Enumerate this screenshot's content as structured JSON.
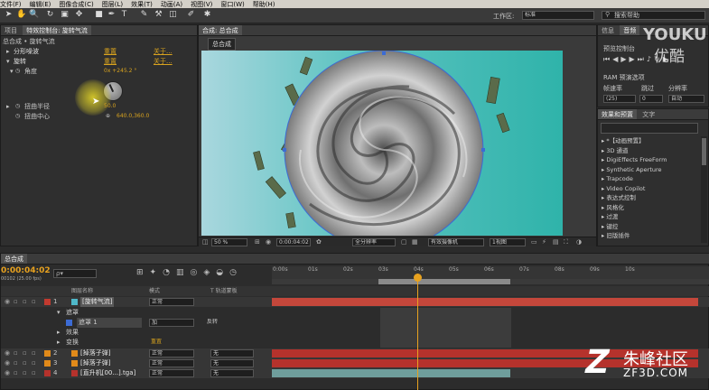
{
  "menu": [
    "文件(F)",
    "编辑(E)",
    "图像合成(C)",
    "图层(L)",
    "效果(T)",
    "动画(A)",
    "视图(V)",
    "窗口(W)",
    "帮助(H)"
  ],
  "toolbar": {
    "workspace_label": "工作区:",
    "workspace_value": "标准",
    "search_placeholder": "搜索帮助"
  },
  "effect_controls": {
    "tabs": [
      "项目",
      "特效控制台: 旋转气流"
    ],
    "breadcrumb": "总合成 • 旋转气流",
    "rows": [
      {
        "name": "分形噪波",
        "reset": "重置",
        "about": "关于..."
      },
      {
        "name": "旋转",
        "reset": "重置",
        "about": "关于..."
      },
      {
        "name": "角度",
        "value": "0x +245.2 °"
      },
      {
        "name": "扭曲半径",
        "value": "50.0"
      },
      {
        "name": "扭曲中心",
        "value": "640.0,360.0"
      }
    ]
  },
  "composition": {
    "tab": "合成: 总合成",
    "subtab": "总合成",
    "footer": {
      "zoom": "50 %",
      "timecode": "0:00:04:02",
      "resolution": "全分辨率",
      "camera": "有效摄像机",
      "view": "1视图"
    }
  },
  "info_panel": {
    "tabs": [
      "信息",
      "音频"
    ],
    "preview_title": "预览控制台",
    "ram_preview": "RAM 预演选项",
    "labels": [
      "帧速率",
      "跳过",
      "分辨率"
    ],
    "values": [
      "(25)",
      "0",
      "自动"
    ]
  },
  "effects_presets": {
    "tabs": [
      "效果和预置",
      "文字"
    ],
    "items": [
      "*【动画预置】",
      "3D 通道",
      "DigiEffects FreeForm",
      "Synthetic Aperture",
      "Trapcode",
      "Video Copilot",
      "表达式控制",
      "风格化",
      "过渡",
      "键控",
      "旧版插件"
    ]
  },
  "timeline": {
    "tab": "总合成",
    "timecode": "0:00:04:02",
    "fps": "00102 (25.00 fps)",
    "search_placeholder": "ρ▾",
    "headers": {
      "name": "图层名称",
      "mode": "模式",
      "trkmat": "T  轨道蒙板"
    },
    "ruler": [
      "0:00s",
      "01s",
      "02s",
      "03s",
      "04s",
      "05s",
      "06s",
      "07s",
      "08s",
      "09s",
      "10s"
    ],
    "layers": [
      {
        "num": "1",
        "name": "[旋转气流]",
        "mode": "正常",
        "trk": "",
        "color": "#4fb8c9"
      },
      {
        "num": "",
        "name": "遮罩",
        "mode": "",
        "trk": ""
      },
      {
        "num": "",
        "name": "遮罩 1",
        "mode": "加",
        "trk": "反转"
      },
      {
        "num": "",
        "name": "效果",
        "mode": "",
        "trk": ""
      },
      {
        "num": "",
        "name": "变换",
        "mode": "重置",
        "trk": ""
      },
      {
        "num": "2",
        "name": "[掉落子弹]",
        "mode": "正常",
        "trk": "无",
        "color": "#e08a1a"
      },
      {
        "num": "3",
        "name": "[掉落子弹]",
        "mode": "正常",
        "trk": "无",
        "color": "#e08a1a"
      },
      {
        "num": "4",
        "name": "[直升机[00...].tga]",
        "mode": "正常",
        "trk": "无",
        "color": "#b5322c"
      }
    ]
  },
  "watermark": {
    "youku": "YOUKU",
    "youku_cn": "优酷",
    "brand_cn": "朱峰社区",
    "brand_en": "ZF3D.COM"
  }
}
